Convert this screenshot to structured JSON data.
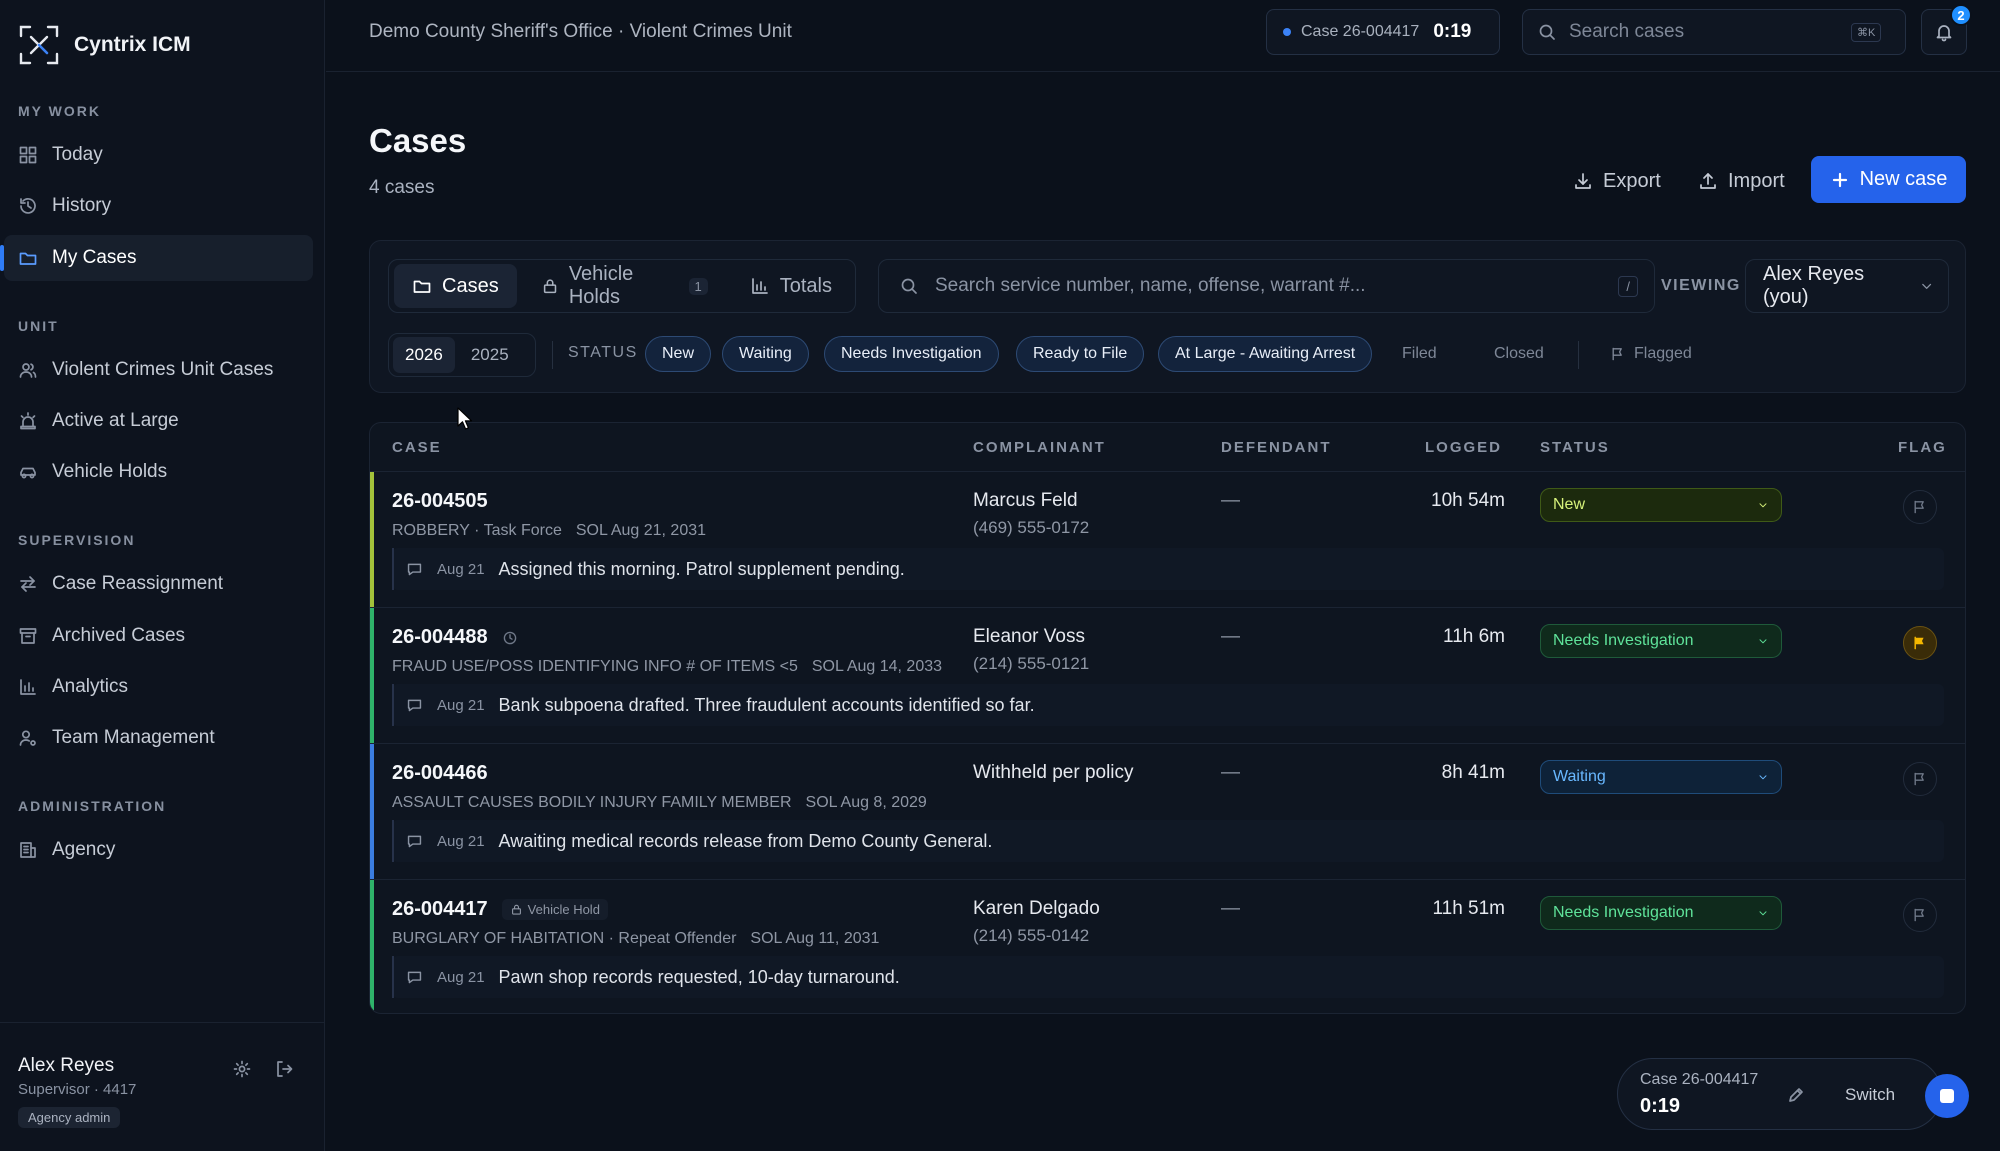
{
  "brand": {
    "name": "Cyntrix ICM"
  },
  "sidebar": {
    "sections": [
      {
        "title": "MY WORK",
        "items": [
          {
            "label": "Today",
            "icon": "grid-icon"
          },
          {
            "label": "History",
            "icon": "history-icon"
          },
          {
            "label": "My Cases",
            "icon": "folder-icon",
            "active": true
          }
        ]
      },
      {
        "title": "UNIT",
        "items": [
          {
            "label": "Violent Crimes Unit Cases",
            "icon": "users-icon"
          },
          {
            "label": "Active at Large",
            "icon": "siren-icon"
          },
          {
            "label": "Vehicle Holds",
            "icon": "car-icon"
          }
        ]
      },
      {
        "title": "SUPERVISION",
        "items": [
          {
            "label": "Case Reassignment",
            "icon": "arrows-icon"
          },
          {
            "label": "Archived Cases",
            "icon": "archive-icon"
          },
          {
            "label": "Analytics",
            "icon": "chart-icon"
          },
          {
            "label": "Team Management",
            "icon": "user-gear-icon"
          }
        ]
      },
      {
        "title": "ADMINISTRATION",
        "items": [
          {
            "label": "Agency",
            "icon": "building-icon"
          }
        ]
      }
    ],
    "user": {
      "name": "Alex Reyes",
      "role": "Supervisor · 4417",
      "badge": "Agency admin"
    }
  },
  "topbar": {
    "org": "Demo County Sheriff's Office · Violent Crimes Unit",
    "timer_case": "Case 26-004417",
    "timer_time": "0:19",
    "search_placeholder": "Search cases",
    "search_shortcut": "⌘K",
    "notification_count": "2"
  },
  "page": {
    "title": "Cases",
    "count": "4 cases",
    "export_label": "Export",
    "import_label": "Import",
    "new_case_label": "New case"
  },
  "filters": {
    "tabs": [
      {
        "label": "Cases",
        "active": true
      },
      {
        "label": "Vehicle Holds",
        "count": "1"
      },
      {
        "label": "Totals"
      }
    ],
    "search_placeholder": "Search service number, name, offense, warrant #...",
    "search_shortcut": "/",
    "viewing_label": "VIEWING",
    "viewing_value": "Alex Reyes (you)",
    "years": [
      {
        "label": "2026",
        "active": true
      },
      {
        "label": "2025"
      }
    ],
    "status_label": "STATUS",
    "status_chips": [
      {
        "label": "New",
        "on": true
      },
      {
        "label": "Waiting",
        "on": true
      },
      {
        "label": "Needs Investigation",
        "on": true
      },
      {
        "label": "Ready to File",
        "on": true
      },
      {
        "label": "At Large - Awaiting Arrest",
        "on": true
      },
      {
        "label": "Filed",
        "on": false
      },
      {
        "label": "Closed",
        "on": false
      }
    ],
    "flagged_label": "Flagged"
  },
  "table": {
    "headers": {
      "case": "CASE",
      "complainant": "COMPLAINANT",
      "defendant": "DEFENDANT",
      "logged": "LOGGED",
      "status": "STATUS",
      "flag": "FLAG"
    },
    "rows": [
      {
        "case_no": "26-004505",
        "offense": "ROBBERY · Task Force",
        "sol": "SOL Aug 21, 2031",
        "complainant": "Marcus Feld",
        "phone": "(469) 555-0172",
        "defendant": "—",
        "logged": "10h 54m",
        "status": "New",
        "accent": "#a3c23a",
        "status_bg": "#1c2a0d",
        "status_border": "#3f5a17",
        "status_color": "#d7f27a",
        "flagged": false,
        "note_date": "Aug 21",
        "note": "Assigned this morning. Patrol supplement pending."
      },
      {
        "case_no": "26-004488",
        "badge_icon": "clock-icon",
        "offense": "FRAUD USE/POSS IDENTIFYING INFO # OF ITEMS <5",
        "sol": "SOL Aug 14, 2033",
        "complainant": "Eleanor Voss",
        "phone": "(214) 555-0121",
        "defendant": "—",
        "logged": "11h 6m",
        "status": "Needs Investigation",
        "accent": "#2fb36a",
        "status_bg": "#0f2a1c",
        "status_border": "#1f5a3a",
        "status_color": "#5fe39a",
        "flagged": true,
        "note_date": "Aug 21",
        "note": "Bank subpoena drafted. Three fraudulent accounts identified so far."
      },
      {
        "case_no": "26-004466",
        "offense": "ASSAULT CAUSES BODILY INJURY FAMILY MEMBER",
        "sol": "SOL Aug 8, 2029",
        "complainant": "Withheld per policy",
        "phone": "",
        "defendant": "—",
        "logged": "8h 41m",
        "status": "Waiting",
        "accent": "#3b7de0",
        "status_bg": "#0e2238",
        "status_border": "#1f4c7a",
        "status_color": "#69b8ff",
        "flagged": false,
        "note_date": "Aug 21",
        "note": "Awaiting medical records release from Demo County General."
      },
      {
        "case_no": "26-004417",
        "badge_label": "Vehicle Hold",
        "offense": "BURGLARY OF HABITATION · Repeat Offender",
        "sol": "SOL Aug 11, 2031",
        "complainant": "Karen Delgado",
        "phone": "(214) 555-0142",
        "defendant": "—",
        "logged": "11h 51m",
        "status": "Needs Investigation",
        "accent": "#2fb36a",
        "status_bg": "#0f2a1c",
        "status_border": "#1f5a3a",
        "status_color": "#5fe39a",
        "flagged": false,
        "note_date": "Aug 21",
        "note": "Pawn shop records requested, 10-day turnaround."
      }
    ]
  },
  "floating_timer": {
    "case": "Case 26-004417",
    "time": "0:19",
    "switch_label": "Switch"
  },
  "colors": {
    "accent": "#2563eb",
    "flag": "#f5b800"
  }
}
